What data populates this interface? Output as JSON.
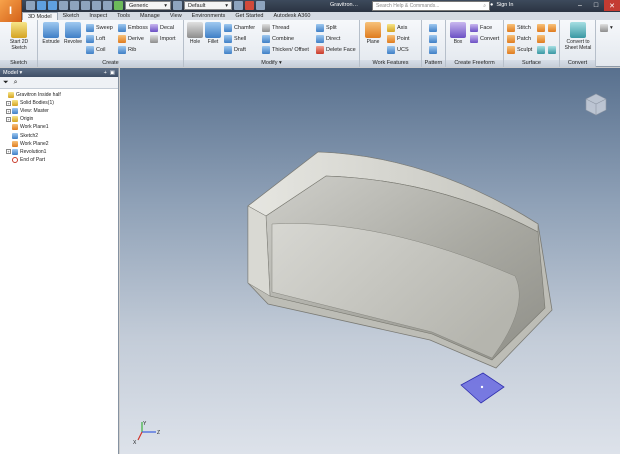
{
  "app": {
    "title": "Gravitron…",
    "logo_glyph": "I"
  },
  "toolbar": {
    "appearance": "Generic",
    "material": "Default",
    "search_placeholder": "Search Help & Commands...",
    "signin": "Sign In"
  },
  "tabs": [
    "3D Model",
    "Sketch",
    "Inspect",
    "Tools",
    "Manage",
    "View",
    "Environments",
    "Get Started",
    "Autodesk A360"
  ],
  "active_tab": "3D Model",
  "ribbon": {
    "sketch": {
      "title": "Sketch",
      "start": "Start 2D Sketch"
    },
    "create": {
      "title": "Create",
      "extrude": "Extrude",
      "revolve": "Revolve",
      "sweep": "Sweep",
      "loft": "Loft",
      "coil": "Coil",
      "emboss": "Emboss",
      "derive": "Derive",
      "rib": "Rib",
      "decal": "Decal",
      "import": "Import"
    },
    "modify": {
      "title": "Modify",
      "hole": "Hole",
      "fillet": "Fillet",
      "chamfer": "Chamfer",
      "shell": "Shell",
      "draft": "Draft",
      "thread": "Thread",
      "combine": "Combine",
      "thicken": "Thicken/ Offset",
      "split": "Split",
      "direct": "Direct",
      "delete_face": "Delete Face"
    },
    "work_features": {
      "title": "Work Features",
      "plane": "Plane",
      "axis": "Axis",
      "point": "Point",
      "ucs": "UCS"
    },
    "pattern": {
      "title": "Pattern"
    },
    "freeform": {
      "title": "Create Freeform",
      "box": "Box",
      "face": "Face",
      "convert": "Convert"
    },
    "surface": {
      "title": "Surface",
      "stitch": "Stitch",
      "patch": "Patch",
      "sculpt": "Sculpt"
    },
    "convert": {
      "title": "Convert",
      "to_sheet": "Convert to Sheet Metal"
    }
  },
  "browser": {
    "title": "Model",
    "tree": [
      {
        "label": "Gravitron Inside half",
        "icon": "part-icon",
        "level": 0,
        "exp": ""
      },
      {
        "label": "Solid Bodies(1)",
        "icon": "folder-icon",
        "level": 1,
        "exp": "+"
      },
      {
        "label": "View: Master",
        "icon": "view-icon",
        "level": 1,
        "exp": "+"
      },
      {
        "label": "Origin",
        "icon": "folder-icon",
        "level": 1,
        "exp": "+"
      },
      {
        "label": "Work Plane1",
        "icon": "plane-icon",
        "level": 1,
        "exp": ""
      },
      {
        "label": "Sketch2",
        "icon": "sketch-icon",
        "level": 1,
        "exp": ""
      },
      {
        "label": "Work Plane2",
        "icon": "plane-icon",
        "level": 1,
        "exp": ""
      },
      {
        "label": "Revolution1",
        "icon": "revolve-icon",
        "level": 1,
        "exp": "+"
      },
      {
        "label": "End of Part",
        "icon": "end-of-part-icon",
        "level": 1,
        "exp": ""
      }
    ]
  },
  "viewport": {
    "triad": {
      "x": "X",
      "y": "Y",
      "z": "Z"
    }
  },
  "colors": {
    "accent": "#3f7fc6",
    "plane": "#5a5ae0",
    "part": "#c9c9c3"
  }
}
